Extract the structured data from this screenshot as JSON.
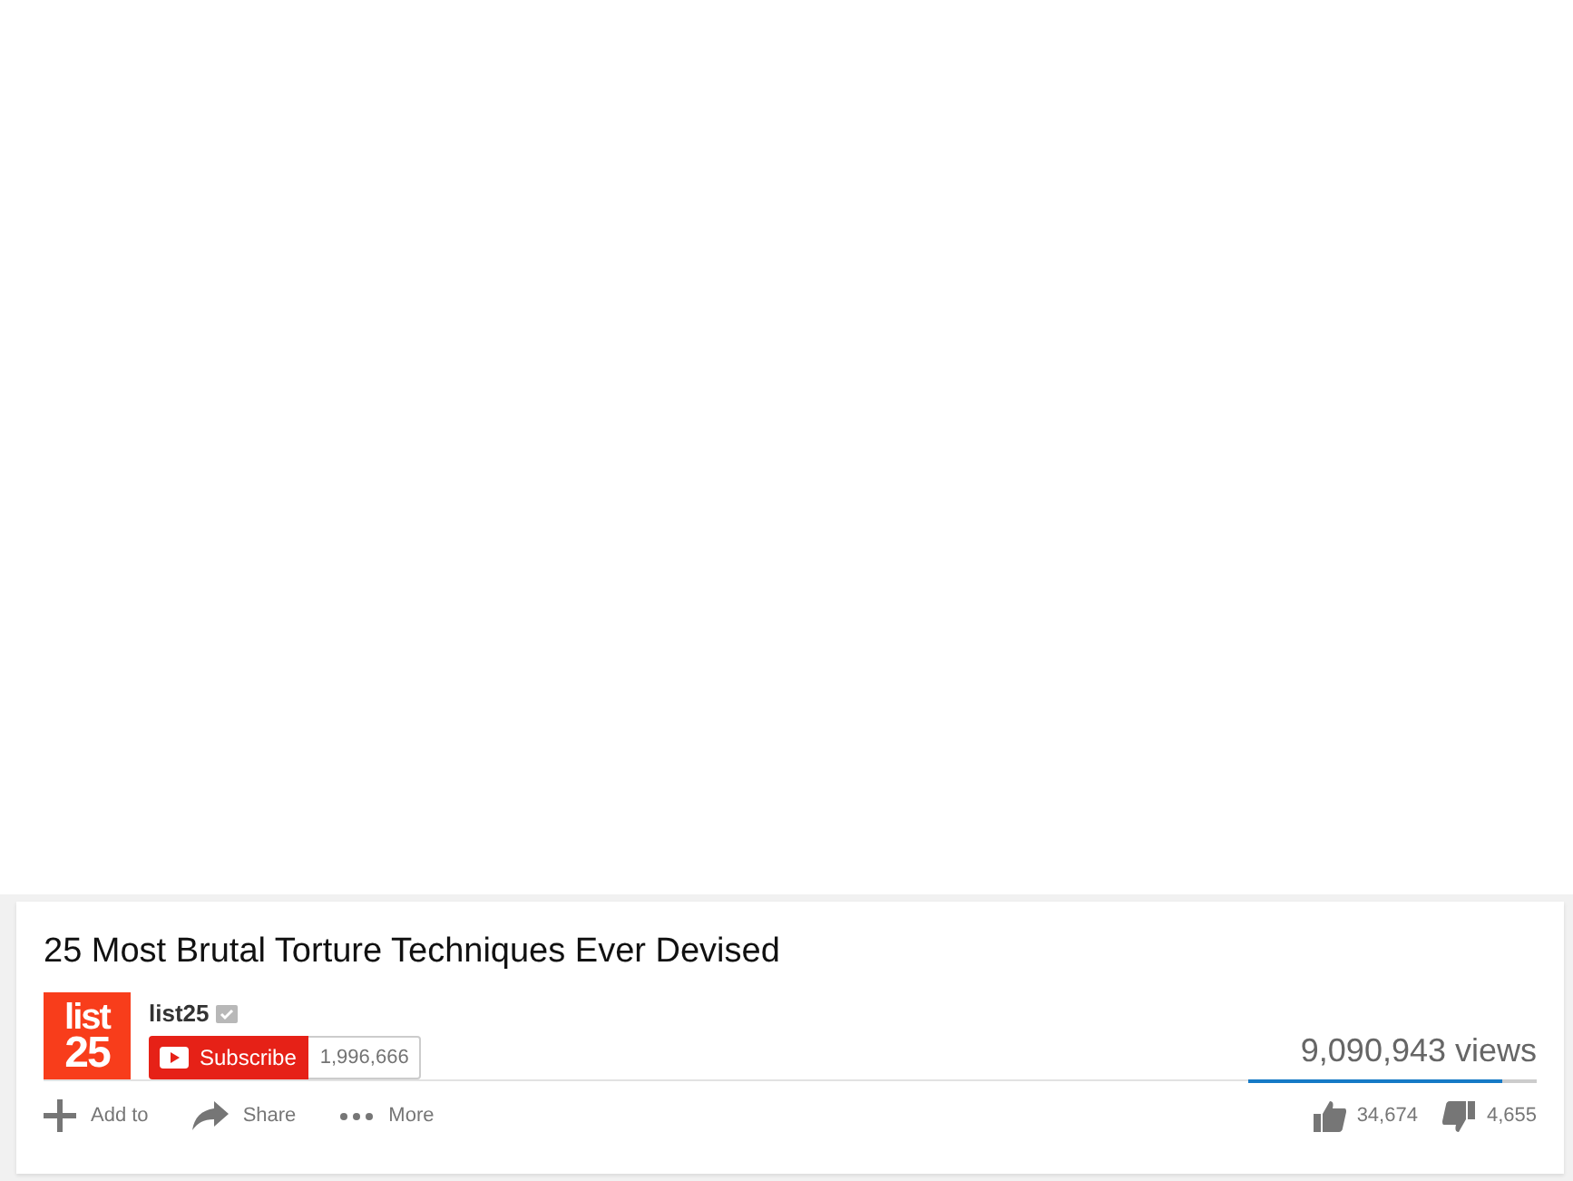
{
  "video": {
    "title": "25 Most Brutal Torture Techniques Ever Devised"
  },
  "channel": {
    "logo": [
      "list",
      "25"
    ],
    "name": "list25",
    "verified": true,
    "subscribe_label": "Subscribe",
    "subscriber_count": "1,996,666"
  },
  "views": "9,090,943 views",
  "sentiment": {
    "level": 0.88
  },
  "actions": [
    {
      "kind": "add",
      "label": "Add to"
    },
    {
      "kind": "share",
      "label": "Share"
    },
    {
      "kind": "more",
      "label": "More"
    }
  ],
  "likes": "34,674",
  "dislikes": "4,655"
}
